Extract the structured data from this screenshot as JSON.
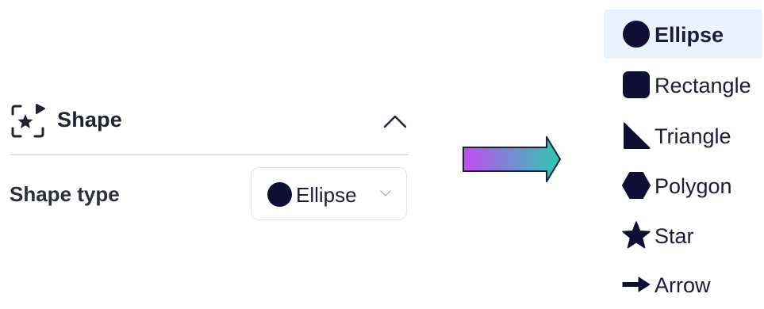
{
  "panel": {
    "title": "Shape",
    "field_label": "Shape type",
    "select_value": "Ellipse"
  },
  "menu": {
    "items": [
      {
        "label": "Ellipse",
        "icon": "ellipse-icon",
        "selected": true
      },
      {
        "label": "Rectangle",
        "icon": "rectangle-icon",
        "selected": false
      },
      {
        "label": "Triangle",
        "icon": "triangle-icon",
        "selected": false
      },
      {
        "label": "Polygon",
        "icon": "polygon-icon",
        "selected": false
      },
      {
        "label": "Star",
        "icon": "star-icon",
        "selected": false
      },
      {
        "label": "Arrow",
        "icon": "arrow-icon",
        "selected": false
      }
    ]
  },
  "colors": {
    "shape_fill": "#0f0f35",
    "selected_bg": "#e9f3fd",
    "arrow_gradient": [
      "#c04df0",
      "#2cc9b0"
    ]
  }
}
